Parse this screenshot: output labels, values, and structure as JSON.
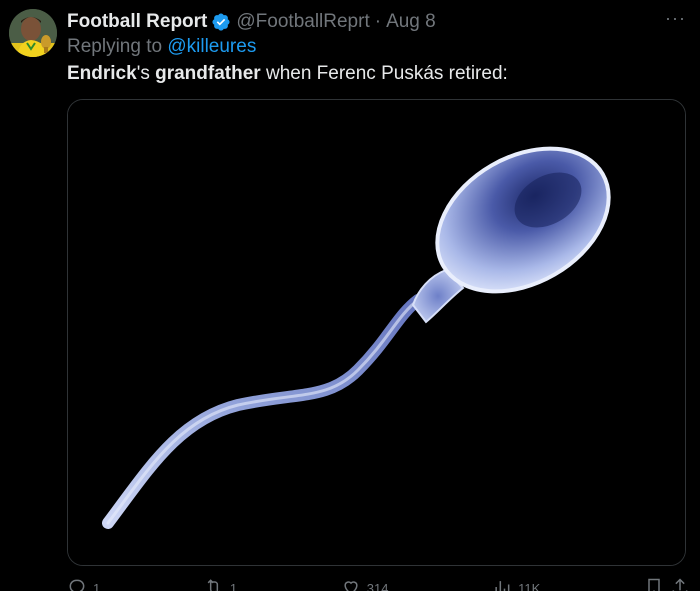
{
  "tweet": {
    "display_name": "Football Report",
    "handle": "@FootballReprt",
    "separator": "·",
    "date": "Aug 8",
    "replying_prefix": "Replying to",
    "replying_to": "@killeures",
    "text_part1": "Endrick",
    "text_part2": "'s ",
    "text_part3": "grandfather",
    "text_part4": " when Ferenc Puskás retired:",
    "more_label": "···"
  },
  "actions": {
    "replies": "1",
    "retweets": "1",
    "likes": "314",
    "views": "11K"
  },
  "colors": {
    "background": "#000000",
    "text": "#e7e9ea",
    "muted": "#71767b",
    "link": "#1d9bf0",
    "verified": "#1d9bf0"
  },
  "icons": [
    "verified-badge-icon",
    "more-icon",
    "reply-icon",
    "retweet-icon",
    "like-icon",
    "views-icon",
    "bookmark-icon",
    "share-icon"
  ]
}
